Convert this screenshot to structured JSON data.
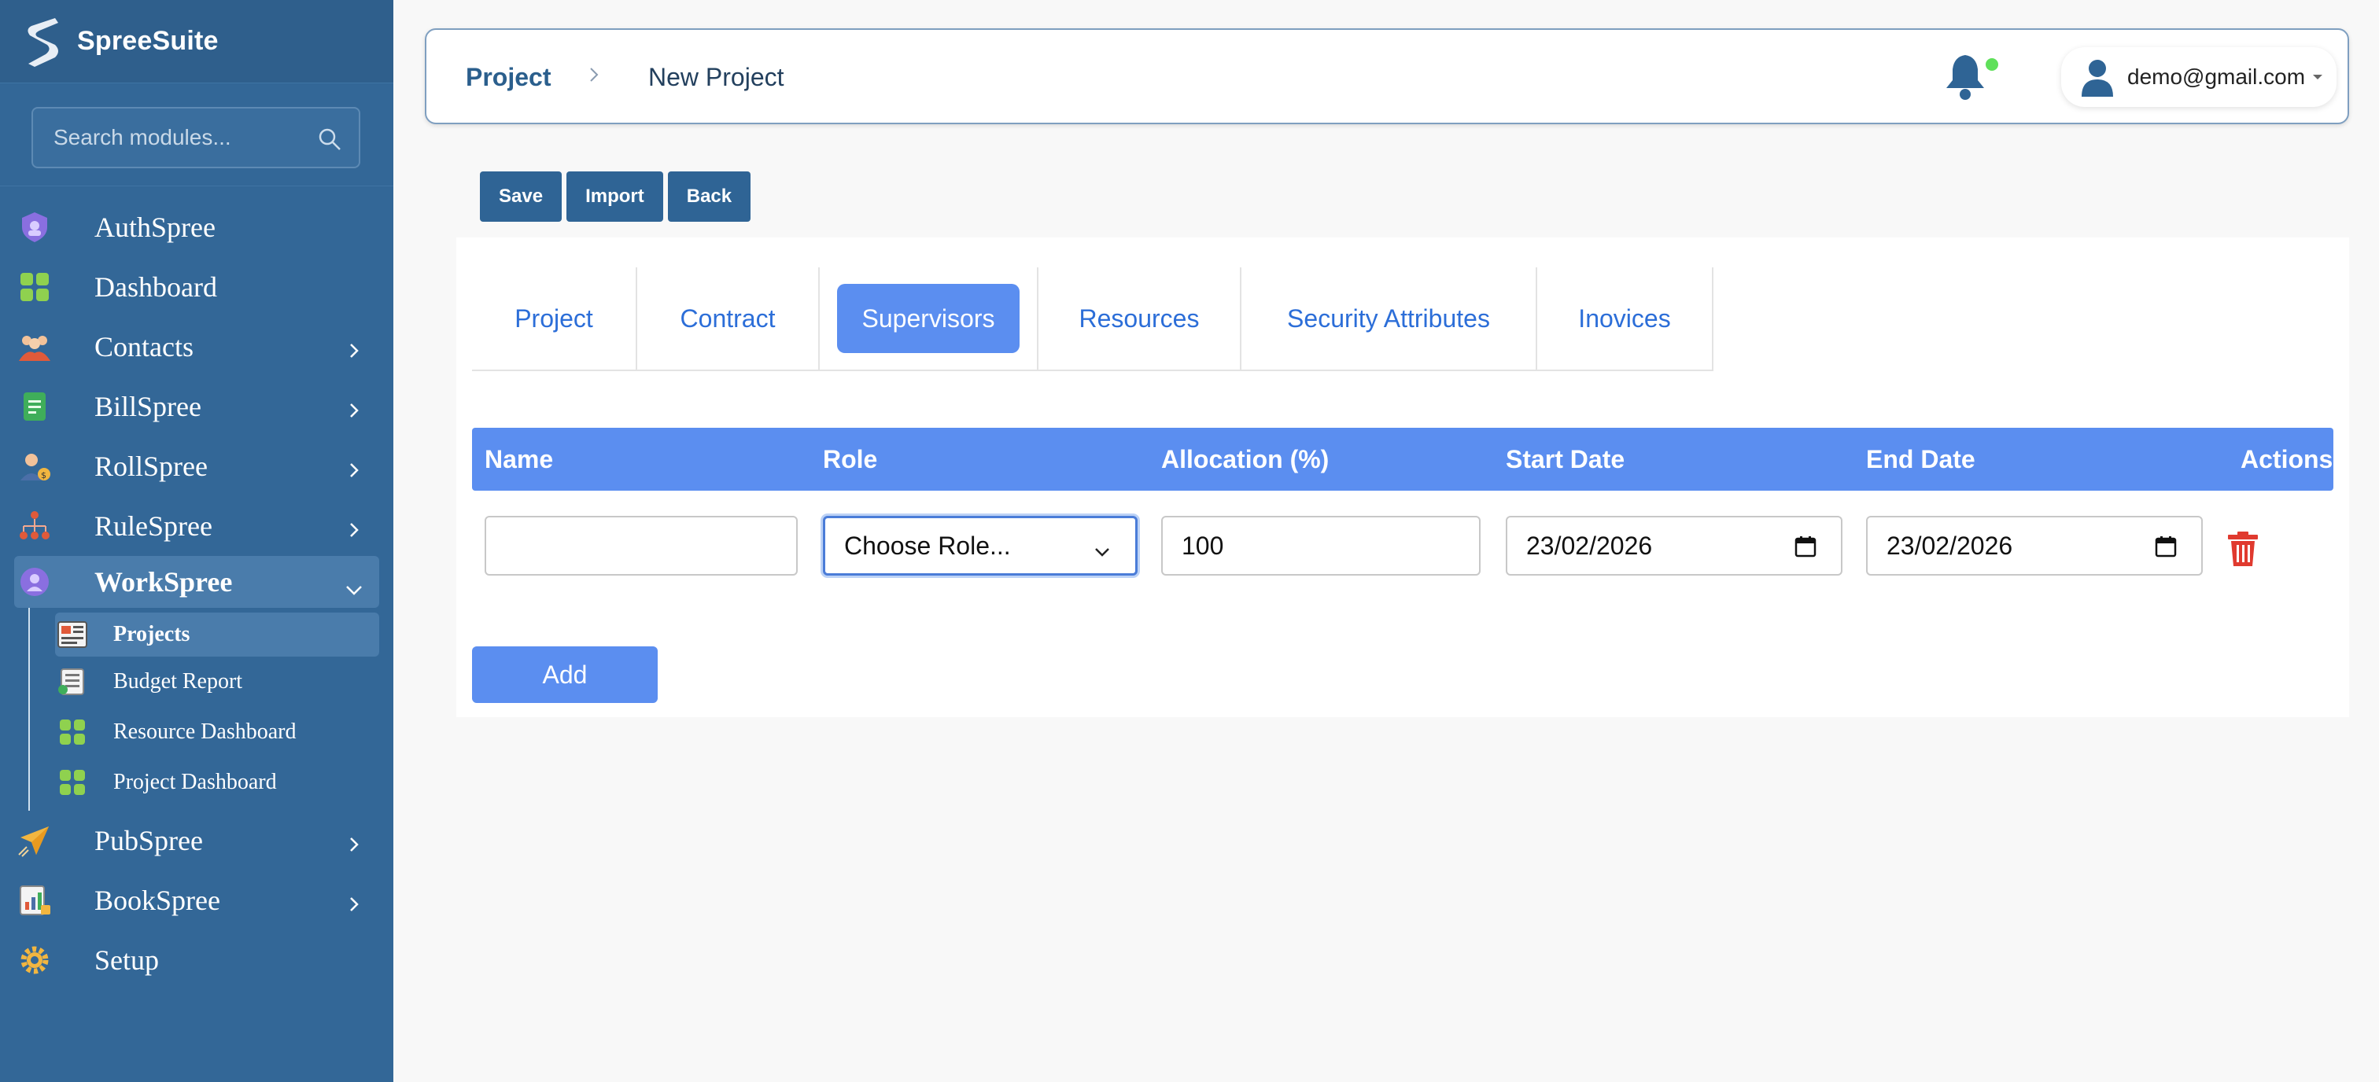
{
  "brand": {
    "name": "SpreeSuite"
  },
  "search": {
    "placeholder": "Search modules..."
  },
  "sidebar": {
    "items": [
      {
        "label": "AuthSpree"
      },
      {
        "label": "Dashboard"
      },
      {
        "label": "Contacts"
      },
      {
        "label": "BillSpree"
      },
      {
        "label": "RollSpree"
      },
      {
        "label": "RuleSpree"
      },
      {
        "label": "WorkSpree"
      },
      {
        "label": "PubSpree"
      },
      {
        "label": "BookSpree"
      },
      {
        "label": "Setup"
      }
    ],
    "workspree_sub": [
      {
        "label": "Projects"
      },
      {
        "label": "Budget Report"
      },
      {
        "label": "Resource Dashboard"
      },
      {
        "label": "Project Dashboard"
      }
    ]
  },
  "header": {
    "breadcrumb_root": "Project",
    "breadcrumb_current": "New Project",
    "user_email": "demo@gmail.com"
  },
  "toolbar": {
    "save": "Save",
    "import": "Import",
    "back": "Back"
  },
  "tabs": [
    {
      "label": "Project"
    },
    {
      "label": "Contract"
    },
    {
      "label": "Supervisors"
    },
    {
      "label": "Resources"
    },
    {
      "label": "Security Attributes"
    },
    {
      "label": "Inovices"
    }
  ],
  "table": {
    "headers": [
      "Name",
      "Role",
      "Allocation (%)",
      "Start Date",
      "End Date",
      "Actions"
    ],
    "row": {
      "name": "",
      "role": "Choose Role...",
      "allocation": "100",
      "start_date": "23/02/2026",
      "end_date": "23/02/2026"
    }
  },
  "add_label": "Add",
  "colors": {
    "sidebar": "#336797",
    "accent": "#5b8ef0",
    "button": "#2f6495",
    "danger": "#e03a2f"
  }
}
